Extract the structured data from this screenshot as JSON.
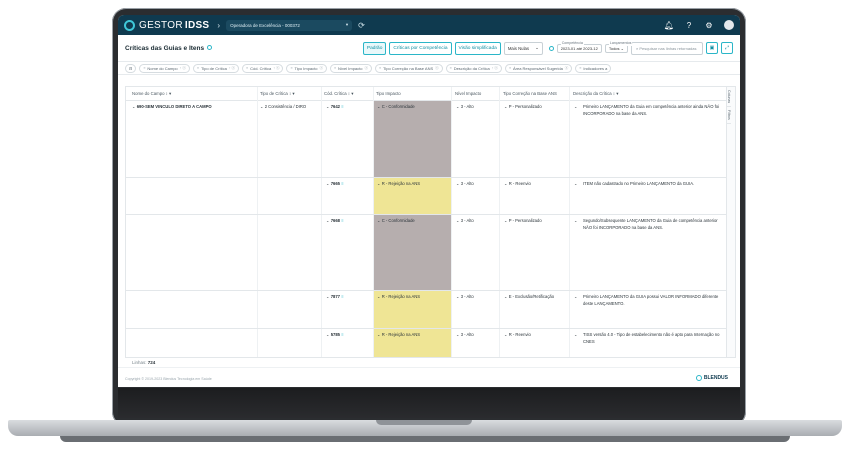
{
  "topbar": {
    "logo_text": "GESTOR",
    "logo_bold": "IDSS",
    "operator_select": "Operadora de Excelência - 000372",
    "icons": [
      "bell-icon",
      "help-icon",
      "settings-icon",
      "user-avatar"
    ]
  },
  "header": {
    "title": "Críticas das Guias e Itens",
    "view_buttons": [
      "Padrão",
      "Críticas por Competência",
      "Visão simplificada"
    ],
    "active_view": 0,
    "sort_select": "Mais Nulas",
    "competencia_label": "Competência",
    "competencia_value": "2023-01 até 2023-12",
    "lancamentos_label": "Lançamentos",
    "lancamentos_value": "Todos",
    "search_placeholder": "Pesquisar nas linhas retornadas"
  },
  "filters": [
    "Nome do Campo",
    "Tipo de Crítica",
    "Cód. Crítica",
    "Tipo Impacto",
    "Nível Impacto",
    "Tipo Correção na Base ANS",
    "Descrição da Crítica",
    "Área Responsável Sugerida",
    "Indicadores a"
  ],
  "columns": [
    "Nome do Campo",
    "Tipo de Crítica",
    "Cód. Crítica",
    "Tipo Impacto",
    "Nível Impacto",
    "Tipo Correção na Base ANS",
    "Descrição da Crítica"
  ],
  "side_tabs": [
    "Colunas",
    "Filtros"
  ],
  "rows": [
    {
      "campo": "690-SEM VINCULO DIRETO A CAMPO",
      "tipo": "2 Consistência / DIRO",
      "codigo": "7642",
      "impacto": "C - Conformidade",
      "impacto_color": "#b6aeae",
      "nivel": "3 - Alto",
      "correcao": "P - Personalizado",
      "descricao": "Primeiro LANÇAMENTO da Guia em competência anterior ainda NÃO foi INCORPORADO na base da ANS."
    },
    {
      "campo": "",
      "tipo": "",
      "codigo": "7665",
      "impacto": "R - Rejeição na ANS",
      "impacto_color": "#efe595",
      "nivel": "3 - Alto",
      "correcao": "R - Reenvio",
      "descricao": "ITEM não cadastrado no Primeiro LANÇAMENTO da GUIA."
    },
    {
      "campo": "",
      "tipo": "",
      "codigo": "7668",
      "impacto": "C - Conformidade",
      "impacto_color": "#b6aeae",
      "nivel": "3 - Alto",
      "correcao": "P - Personalizado",
      "descricao": "Segundo/Subsequente LANÇAMENTO da Guia de competência anterior NÃO foi INCORPORADO na base da ANS."
    },
    {
      "campo": "",
      "tipo": "",
      "codigo": "7877",
      "impacto": "R - Rejeição na ANS",
      "impacto_color": "#efe595",
      "nivel": "3 - Alto",
      "correcao": "E - Exclusão/Retificação",
      "descricao": "Primeiro LANÇAMENTO da GUIA possui VALOR INFORMADO diferente deste LANÇAMENTO."
    },
    {
      "campo": "",
      "tipo": "",
      "codigo": "5785",
      "impacto": "R - Rejeição na ANS",
      "impacto_color": "#efe595",
      "nivel": "3 - Alto",
      "correcao": "R - Reenvio",
      "descricao": "TISS versão 4.0 - Tipo de estabelecimento não é apto para Internação no CNES"
    }
  ],
  "footer": {
    "linhas_label": "Linhas:",
    "linhas_value": "724",
    "copyright": "Copyright © 2019-2023 Blendus Tecnologia em Saúde",
    "brand": "BLENDUS"
  },
  "colors": {
    "topbar": "#0f3a4f",
    "accent": "#2bb6c8",
    "conformidade": "#b6aeae",
    "rejeicao": "#efe595"
  }
}
